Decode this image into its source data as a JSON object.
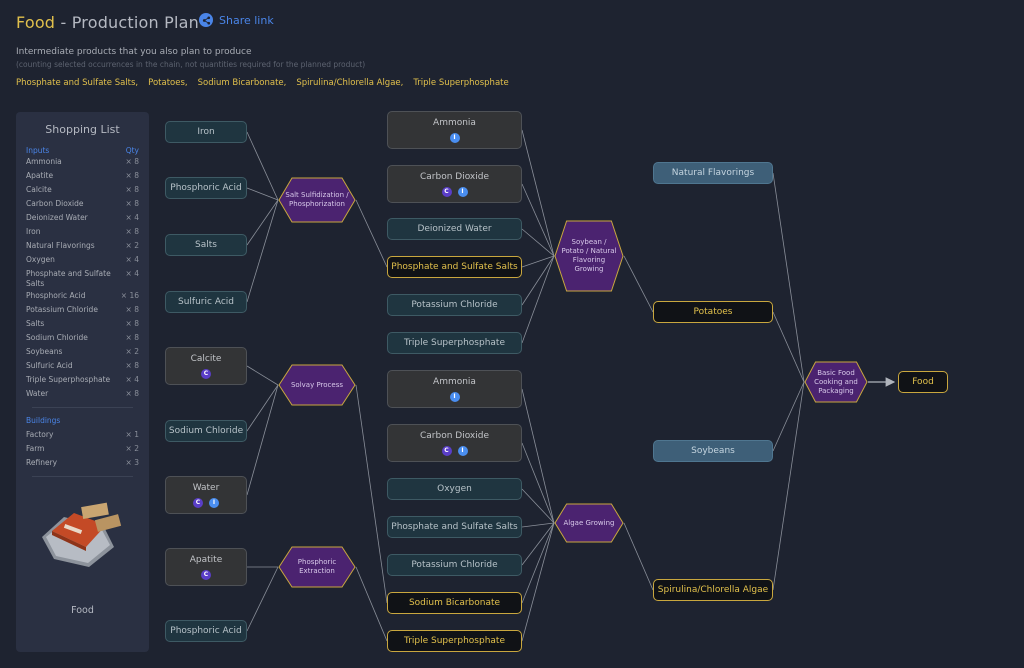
{
  "header": {
    "product": "Food",
    "title_suffix": " - Production Plan",
    "share_label": "Share link"
  },
  "intro": {
    "subtitle": "Intermediate products that you also plan to produce",
    "note": "(counting selected occurrences in the chain, not quantities required for the planned product)",
    "intermediates": [
      "Phosphate and Sulfate Salts,",
      "Potatoes,",
      "Sodium Bicarbonate,",
      "Spirulina/Chlorella Algae,",
      "Triple Superphosphate"
    ]
  },
  "shopping_list": {
    "title": "Shopping List",
    "inputs_header": "Inputs",
    "qty_header": "Qty",
    "inputs": [
      {
        "name": "Ammonia",
        "qty": "× 8"
      },
      {
        "name": "Apatite",
        "qty": "× 8"
      },
      {
        "name": "Calcite",
        "qty": "× 8"
      },
      {
        "name": "Carbon Dioxide",
        "qty": "× 8"
      },
      {
        "name": "Deionized Water",
        "qty": "× 4"
      },
      {
        "name": "Iron",
        "qty": "× 8"
      },
      {
        "name": "Natural Flavorings",
        "qty": "× 2"
      },
      {
        "name": "Oxygen",
        "qty": "× 4"
      },
      {
        "name": "Phosphate and Sulfate Salts",
        "qty": "× 4"
      },
      {
        "name": "Phosphoric Acid",
        "qty": "× 16"
      },
      {
        "name": "Potassium Chloride",
        "qty": "× 8"
      },
      {
        "name": "Salts",
        "qty": "× 8"
      },
      {
        "name": "Sodium Chloride",
        "qty": "× 8"
      },
      {
        "name": "Soybeans",
        "qty": "× 2"
      },
      {
        "name": "Sulfuric Acid",
        "qty": "× 8"
      },
      {
        "name": "Triple Superphosphate",
        "qty": "× 4"
      },
      {
        "name": "Water",
        "qty": "× 8"
      }
    ],
    "buildings_header": "Buildings",
    "buildings": [
      {
        "name": "Factory",
        "qty": "× 1"
      },
      {
        "name": "Farm",
        "qty": "× 2"
      },
      {
        "name": "Refinery",
        "qty": "× 3"
      }
    ],
    "product_label": "Food"
  },
  "graph": {
    "nodes": [
      {
        "id": "n_iron",
        "label": "Iron",
        "style": "teal",
        "badges": []
      },
      {
        "id": "n_phos1",
        "label": "Phosphoric Acid",
        "style": "teal",
        "badges": []
      },
      {
        "id": "n_salts",
        "label": "Salts",
        "style": "teal",
        "badges": []
      },
      {
        "id": "n_sulf",
        "label": "Sulfuric Acid",
        "style": "teal",
        "badges": []
      },
      {
        "id": "n_calcite",
        "label": "Calcite",
        "style": "gray",
        "badges": [
          "C"
        ]
      },
      {
        "id": "n_nacl",
        "label": "Sodium Chloride",
        "style": "teal",
        "badges": []
      },
      {
        "id": "n_water",
        "label": "Water",
        "style": "gray",
        "badges": [
          "C",
          "I"
        ]
      },
      {
        "id": "n_apatite",
        "label": "Apatite",
        "style": "gray",
        "badges": [
          "C"
        ]
      },
      {
        "id": "n_phos2",
        "label": "Phosphoric Acid",
        "style": "teal",
        "badges": []
      },
      {
        "id": "n_amm1",
        "label": "Ammonia",
        "style": "gray",
        "badges": [
          "I"
        ]
      },
      {
        "id": "n_co2a",
        "label": "Carbon Dioxide",
        "style": "gray",
        "badges": [
          "C",
          "I"
        ]
      },
      {
        "id": "n_diw",
        "label": "Deionized Water",
        "style": "teal",
        "badges": []
      },
      {
        "id": "n_pss1",
        "label": "Phosphate and Sulfate Salts",
        "style": "gold",
        "badges": []
      },
      {
        "id": "n_kcl1",
        "label": "Potassium Chloride",
        "style": "teal",
        "badges": []
      },
      {
        "id": "n_tsp1",
        "label": "Triple Superphosphate",
        "style": "teal",
        "badges": []
      },
      {
        "id": "n_amm2",
        "label": "Ammonia",
        "style": "gray",
        "badges": [
          "I"
        ]
      },
      {
        "id": "n_co2b",
        "label": "Carbon Dioxide",
        "style": "gray",
        "badges": [
          "C",
          "I"
        ]
      },
      {
        "id": "n_oxy",
        "label": "Oxygen",
        "style": "teal",
        "badges": []
      },
      {
        "id": "n_pss2",
        "label": "Phosphate and Sulfate Salts",
        "style": "teal",
        "badges": []
      },
      {
        "id": "n_kcl2",
        "label": "Potassium Chloride",
        "style": "teal",
        "badges": []
      },
      {
        "id": "n_sbc",
        "label": "Sodium Bicarbonate",
        "style": "gold",
        "badges": []
      },
      {
        "id": "n_tsp2",
        "label": "Triple Superphosphate",
        "style": "gold",
        "badges": []
      },
      {
        "id": "n_natf",
        "label": "Natural Flavorings",
        "style": "blue",
        "badges": []
      },
      {
        "id": "n_pot",
        "label": "Potatoes",
        "style": "gold",
        "badges": []
      },
      {
        "id": "n_soy",
        "label": "Soybeans",
        "style": "blue",
        "badges": []
      },
      {
        "id": "n_alg",
        "label": "Spirulina/Chlorella Algae",
        "style": "gold",
        "badges": []
      },
      {
        "id": "n_food",
        "label": "Food",
        "style": "gold",
        "badges": []
      }
    ],
    "processes": [
      {
        "id": "p_salt",
        "label": "Salt Sulfidization / Phosphorization"
      },
      {
        "id": "p_solvay",
        "label": "Solvay Process"
      },
      {
        "id": "p_phosx",
        "label": "Phosphoric Extraction"
      },
      {
        "id": "p_soy",
        "label": "Soybean / Potato / Natural Flavoring Growing"
      },
      {
        "id": "p_algae",
        "label": "Algae Growing"
      },
      {
        "id": "p_food",
        "label": "Basic Food Cooking and Packaging"
      }
    ],
    "edges": [
      [
        "n_iron",
        "p_salt"
      ],
      [
        "n_phos1",
        "p_salt"
      ],
      [
        "n_salts",
        "p_salt"
      ],
      [
        "n_sulf",
        "p_salt"
      ],
      [
        "p_salt",
        "n_pss1"
      ],
      [
        "n_calcite",
        "p_solvay"
      ],
      [
        "n_nacl",
        "p_solvay"
      ],
      [
        "n_water",
        "p_solvay"
      ],
      [
        "p_solvay",
        "n_sbc"
      ],
      [
        "n_apatite",
        "p_phosx"
      ],
      [
        "n_phos2",
        "p_phosx"
      ],
      [
        "p_phosx",
        "n_tsp2"
      ],
      [
        "n_amm1",
        "p_soy"
      ],
      [
        "n_co2a",
        "p_soy"
      ],
      [
        "n_diw",
        "p_soy"
      ],
      [
        "n_pss1",
        "p_soy"
      ],
      [
        "n_kcl1",
        "p_soy"
      ],
      [
        "n_tsp1",
        "p_soy"
      ],
      [
        "p_soy",
        "n_pot"
      ],
      [
        "n_amm2",
        "p_algae"
      ],
      [
        "n_co2b",
        "p_algae"
      ],
      [
        "n_oxy",
        "p_algae"
      ],
      [
        "n_pss2",
        "p_algae"
      ],
      [
        "n_kcl2",
        "p_algae"
      ],
      [
        "n_sbc",
        "p_algae"
      ],
      [
        "n_tsp2",
        "p_algae"
      ],
      [
        "p_algae",
        "n_alg"
      ],
      [
        "n_natf",
        "p_food"
      ],
      [
        "n_pot",
        "p_food"
      ],
      [
        "n_soy",
        "p_food"
      ],
      [
        "n_alg",
        "p_food"
      ],
      [
        "p_food",
        "n_food"
      ]
    ]
  }
}
